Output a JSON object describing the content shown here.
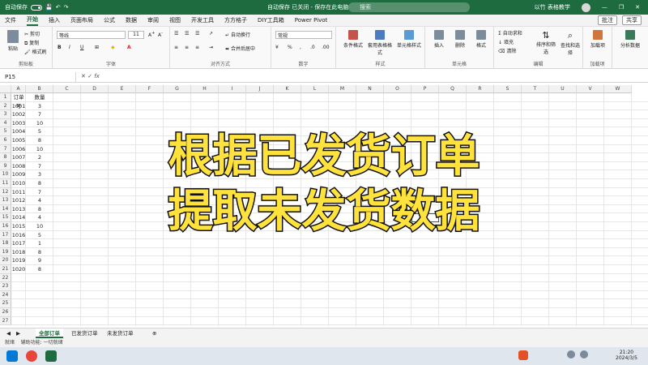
{
  "titlebar": {
    "autosave_label": "自动保存",
    "toggle_state": "关",
    "title": "自动保存 已关闭 - 保存在此电脑",
    "search_placeholder": "搜索",
    "user_name": "以竹 表格教学"
  },
  "menu": {
    "tabs": [
      "文件",
      "开始",
      "插入",
      "页面布局",
      "公式",
      "数据",
      "审阅",
      "视图",
      "开发工具",
      "方方格子",
      "DIY工具箱",
      "Power Pivot"
    ],
    "active_index": 1,
    "comment_btn": "批注",
    "share_btn": "共享"
  },
  "ribbon": {
    "clipboard": {
      "paste": "粘贴",
      "cut": "剪切",
      "copy": "复制",
      "format_painter": "格式刷",
      "label": "剪贴板"
    },
    "font": {
      "name": "等线",
      "size": "11",
      "bold": "B",
      "italic": "I",
      "underline": "U",
      "label": "字体"
    },
    "alignment": {
      "wrap": "自动换行",
      "merge": "合并后居中",
      "label": "对齐方式"
    },
    "number": {
      "format": "常规",
      "label": "数字"
    },
    "styles": {
      "conditional": "条件格式",
      "table": "套用表格格式",
      "cell": "单元格样式",
      "label": "样式"
    },
    "cells": {
      "insert": "插入",
      "delete": "删除",
      "format": "格式",
      "label": "单元格"
    },
    "editing": {
      "autosum": "自动求和",
      "fill": "填充",
      "clear": "清除",
      "sort": "排序和筛选",
      "find": "查找和选择",
      "label": "编辑"
    },
    "addins": {
      "label": "加载项",
      "btn": "加载项"
    },
    "analyze": {
      "btn": "分析数据"
    }
  },
  "formula_bar": {
    "name_box": "P15",
    "fx": "fx",
    "content": ""
  },
  "columns": [
    "A",
    "B",
    "C",
    "D",
    "E",
    "F",
    "G",
    "H",
    "I",
    "J",
    "K",
    "L",
    "M",
    "N",
    "O",
    "P",
    "Q",
    "R",
    "S",
    "T",
    "U",
    "V",
    "W"
  ],
  "rows": [
    "1",
    "2",
    "3",
    "4",
    "5",
    "6",
    "7",
    "8",
    "9",
    "10",
    "11",
    "12",
    "13",
    "14",
    "15",
    "16",
    "17",
    "18",
    "19",
    "20",
    "21",
    "22",
    "23",
    "24",
    "25",
    "26",
    "27"
  ],
  "sheet": {
    "headers": [
      "订单号",
      "数量"
    ],
    "data": [
      [
        "1001",
        "3"
      ],
      [
        "1002",
        "7"
      ],
      [
        "1003",
        "10"
      ],
      [
        "1004",
        "5"
      ],
      [
        "1005",
        "8"
      ],
      [
        "1006",
        "10"
      ],
      [
        "1007",
        "2"
      ],
      [
        "1008",
        "7"
      ],
      [
        "1009",
        "3"
      ],
      [
        "1010",
        "8"
      ],
      [
        "1011",
        "7"
      ],
      [
        "1012",
        "4"
      ],
      [
        "1013",
        "8"
      ],
      [
        "1014",
        "4"
      ],
      [
        "1015",
        "10"
      ],
      [
        "1016",
        "5"
      ],
      [
        "1017",
        "1"
      ],
      [
        "1018",
        "8"
      ],
      [
        "1019",
        "9"
      ],
      [
        "1020",
        "8"
      ]
    ]
  },
  "overlay": {
    "line1": "根据已发货订单",
    "line2": "提取未发货数据"
  },
  "sheet_tabs": [
    "全部订单",
    "已发货订单",
    "未发货订单"
  ],
  "active_sheet": 0,
  "status": {
    "ready": "就绪",
    "accessibility": "辅助功能: 一切就绪"
  },
  "taskbar": {
    "time": "21:20",
    "date": "2024/3/5"
  },
  "colors": {
    "accent": "#1e6b3f",
    "overlay_fill": "#ffe33c",
    "overlay_stroke": "#111111"
  }
}
